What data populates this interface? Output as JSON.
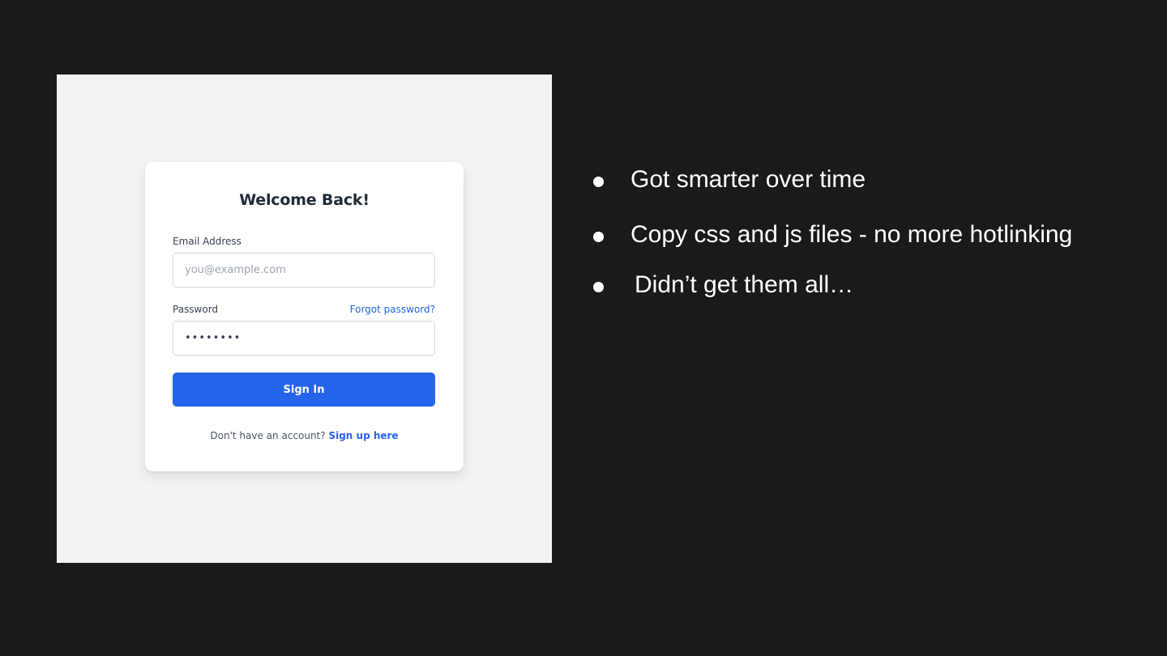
{
  "login_form": {
    "title": "Welcome Back!",
    "email_label": "Email Address",
    "email_placeholder": "you@example.com",
    "email_value": "",
    "password_label": "Password",
    "forgot_password_link": "Forgot password?",
    "password_value": "••••••••",
    "signin_button_label": "Sign In",
    "no_account_text": "Don't have an account?",
    "signup_link": "Sign up here"
  },
  "bullets": [
    "Got smarter over time",
    "Copy css and js files - no more hotlinking",
    "Didn’t get them all…"
  ],
  "colors": {
    "slide_background": "#1a1a1c",
    "panel_background": "#f1f3f5",
    "accent": "#2563eb",
    "bullet_text": "#ffffff"
  }
}
